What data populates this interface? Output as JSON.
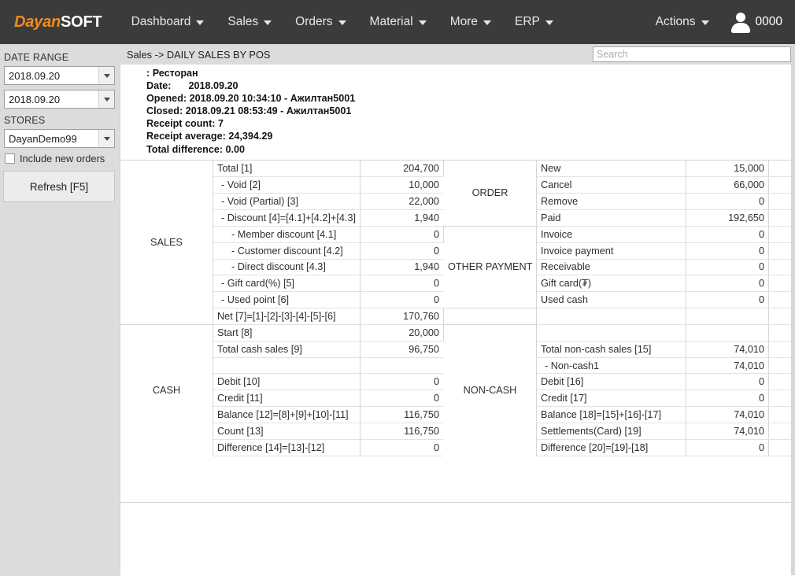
{
  "brand": {
    "part1": "Dayan",
    "part2": "SOFT"
  },
  "topnav": {
    "items": [
      {
        "label": "Dashboard",
        "icon": "chevron-down-icon"
      },
      {
        "label": "Sales",
        "icon": "chevron-down-icon"
      },
      {
        "label": "Orders",
        "icon": "chevron-down-icon"
      },
      {
        "label": "Material",
        "icon": "chevron-down-icon"
      },
      {
        "label": "More",
        "icon": "chevron-down-icon"
      },
      {
        "label": "ERP",
        "icon": "chevron-down-icon"
      }
    ],
    "actions_label": "Actions",
    "user_id": "0000"
  },
  "sidebar": {
    "date_range_label": "DATE RANGE",
    "date_from": "2018.09.20",
    "date_to": "2018.09.20",
    "stores_label": "STORES",
    "store": "DayanDemo99",
    "include_new_orders_label": "Include new orders",
    "include_new_orders_checked": false,
    "refresh_label": "Refresh [F5]"
  },
  "breadcrumb": "Sales -> DAILY SALES BY POS",
  "search": {
    "value": "",
    "placeholder": "Search"
  },
  "detail": {
    "pos_name": ": Ресторан",
    "date_label": "Date:",
    "date_value": "2018.09.20",
    "opened_label": "Opened:",
    "opened_value": "2018.09.20 10:34:10 - Ажилтан5001",
    "closed_label": "Closed:",
    "closed_value": "2018.09.21 08:53:49 - Ажилтан5001",
    "receipt_count_label": "Receipt count:",
    "receipt_count_value": "7",
    "receipt_average_label": "Receipt average:",
    "receipt_average_value": "24,394.29",
    "total_difference_label": "Total difference:",
    "total_difference_value": "0.00"
  },
  "grid": {
    "left_groups": [
      {
        "label": "SALES",
        "rows": 10
      },
      {
        "label": "CASH",
        "rows": 8
      }
    ],
    "right_groups": [
      {
        "label": "ORDER",
        "rows": 4
      },
      {
        "label": "OTHER PAYMENT",
        "rows": 5
      },
      {
        "label": "",
        "rows": 1
      },
      {
        "label": "NON-CASH",
        "rows": 8
      }
    ],
    "left_rows": [
      {
        "name": "Total [1]",
        "value": "204,700",
        "indent": 0
      },
      {
        "name": "- Void [2]",
        "value": "10,000",
        "indent": 1
      },
      {
        "name": "- Void (Partial) [3]",
        "value": "22,000",
        "indent": 1
      },
      {
        "name": "- Discount [4]=[4.1]+[4.2]+[4.3]",
        "value": "1,940",
        "indent": 1
      },
      {
        "name": "- Member discount [4.1]",
        "value": "0",
        "indent": 2
      },
      {
        "name": "- Customer discount [4.2]",
        "value": "0",
        "indent": 2
      },
      {
        "name": "- Direct discount [4.3]",
        "value": "1,940",
        "indent": 2
      },
      {
        "name": "- Gift card(%) [5]",
        "value": "0",
        "indent": 1
      },
      {
        "name": "- Used point [6]",
        "value": "0",
        "indent": 1
      },
      {
        "name": "Net [7]=[1]-[2]-[3]-[4]-[5]-[6]",
        "value": "170,760",
        "indent": 0
      },
      {
        "name": "Start [8]",
        "value": "20,000",
        "indent": 0
      },
      {
        "name": "Total cash sales [9]",
        "value": "96,750",
        "indent": 0
      },
      {
        "name": "",
        "value": "",
        "indent": 0
      },
      {
        "name": "Debit [10]",
        "value": "0",
        "indent": 0
      },
      {
        "name": "Credit [11]",
        "value": "0",
        "indent": 0
      },
      {
        "name": "Balance [12]=[8]+[9]+[10]-[11]",
        "value": "116,750",
        "indent": 0
      },
      {
        "name": "Count [13]",
        "value": "116,750",
        "indent": 0
      },
      {
        "name": "Difference [14]=[13]-[12]",
        "value": "0",
        "indent": 0
      }
    ],
    "right_rows": [
      {
        "name": "New",
        "value": "15,000",
        "indent": 0
      },
      {
        "name": "Cancel",
        "value": "66,000",
        "indent": 0
      },
      {
        "name": "Remove",
        "value": "0",
        "indent": 0
      },
      {
        "name": "Paid",
        "value": "192,650",
        "indent": 0
      },
      {
        "name": "Invoice",
        "value": "0",
        "indent": 0
      },
      {
        "name": "Invoice payment",
        "value": "0",
        "indent": 0
      },
      {
        "name": "Receivable",
        "value": "0",
        "indent": 0
      },
      {
        "name": "Gift card(₮)",
        "value": "0",
        "indent": 0
      },
      {
        "name": "Used cash",
        "value": "0",
        "indent": 0
      },
      {
        "name": "",
        "value": "",
        "indent": 0
      },
      {
        "name": "",
        "value": "",
        "indent": 0
      },
      {
        "name": "Total non-cash sales [15]",
        "value": "74,010",
        "indent": 0
      },
      {
        "name": "- Non-cash1",
        "value": "74,010",
        "indent": 1
      },
      {
        "name": "Debit [16]",
        "value": "0",
        "indent": 0
      },
      {
        "name": "Credit [17]",
        "value": "0",
        "indent": 0
      },
      {
        "name": "Balance [18]=[15]+[16]-[17]",
        "value": "74,010",
        "indent": 0
      },
      {
        "name": "Settlements(Card) [19]",
        "value": "74,010",
        "indent": 0
      },
      {
        "name": "Difference [20]=[19]-[18]",
        "value": "0",
        "indent": 0
      }
    ]
  },
  "colors": {
    "nav_bg": "#3b3b3b",
    "brand_orange": "#ef8c22",
    "chrome_gray": "#dcdcdc",
    "panel_white": "#ffffff",
    "grid_line": "#d6d6d6"
  }
}
